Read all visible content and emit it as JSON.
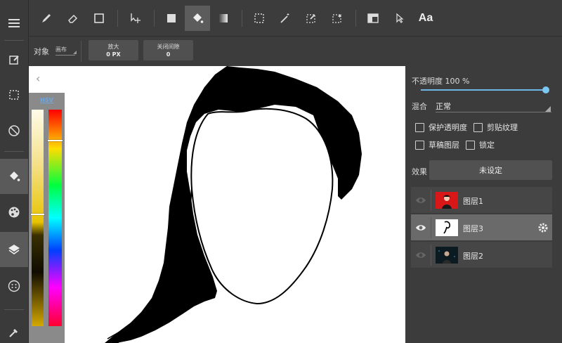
{
  "top_toolbar": {
    "icons": [
      "pen-icon",
      "eraser-icon",
      "rectangle-icon",
      "move-icon",
      "fill-square-icon",
      "bucket-icon",
      "gradient-icon",
      "marquee-icon",
      "magic-wand-icon",
      "lasso-edit-icon",
      "select-pen-icon",
      "panel-layout-icon",
      "cursor-icon",
      "text-icon"
    ],
    "text_tool_label": "Aa"
  },
  "left_rail": {
    "icons": [
      "menu-icon",
      "edit-icon",
      "selection-icon",
      "transform-icon",
      "bucket-icon",
      "palette-icon",
      "layers-icon",
      "dots-icon",
      "eyedropper-icon"
    ]
  },
  "tool_options": {
    "object_label": "对象",
    "object_value": "画布",
    "zoom_label": "放大",
    "zoom_value": "0 PX",
    "close_gap_label": "关闭间隙",
    "close_gap_value": "0"
  },
  "color_picker": {
    "mode_label": "HSV",
    "saturation_level": 0.48,
    "hue_level": 0.14
  },
  "layer_panel": {
    "opacity_label": "不透明度 100 %",
    "opacity_value": 100,
    "blend_label": "混合",
    "blend_value": "正常",
    "checkboxes": {
      "protect_transparency": "保护透明度",
      "clipping": "剪贴纹理",
      "draft_layer": "草稿图层",
      "lock": "锁定"
    },
    "effect_label": "效果",
    "effect_value": "未设定",
    "layers": [
      {
        "name": "图层1",
        "visible": false,
        "selected": false
      },
      {
        "name": "图层3",
        "visible": true,
        "selected": true
      },
      {
        "name": "图层2",
        "visible": false,
        "selected": false
      }
    ]
  },
  "colors": {
    "accent": "#6db8e8",
    "panel_bg": "#3c3c3c",
    "selected_layer": "#6a6a6a"
  }
}
